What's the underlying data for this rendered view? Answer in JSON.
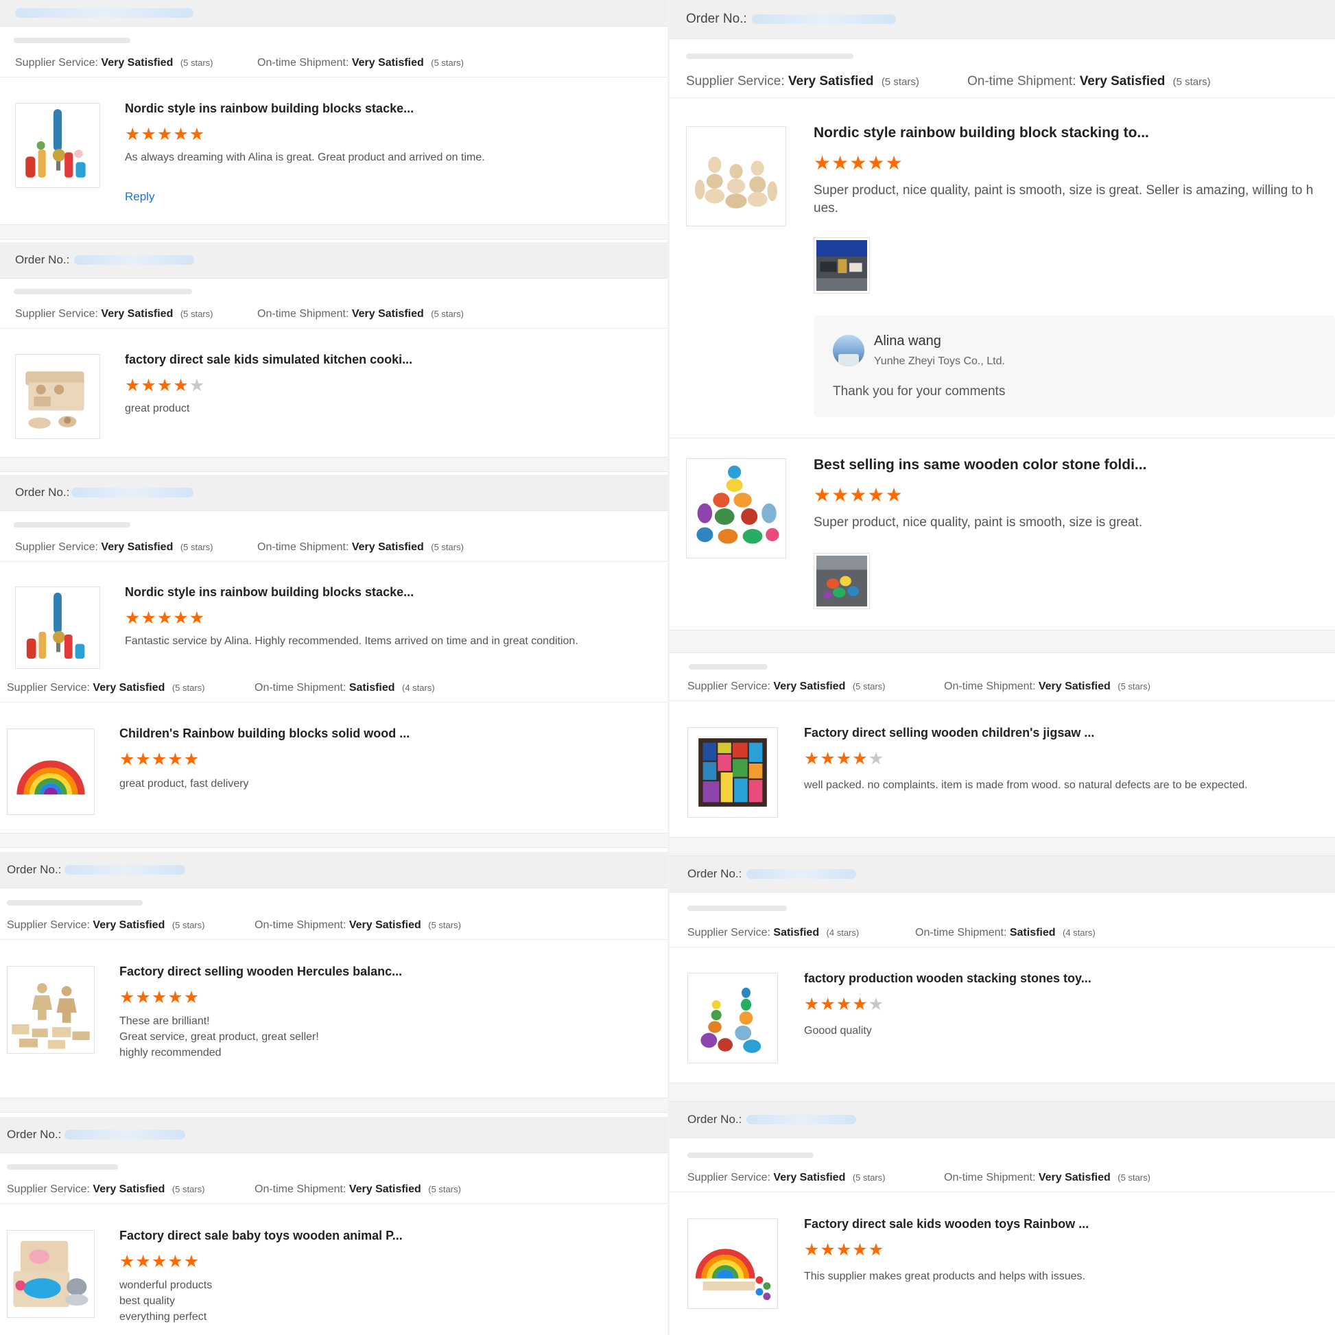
{
  "labels": {
    "order_no": "Order No.:",
    "supplier_service": "Supplier Service:",
    "ontime_shipment": "On-time Shipment:",
    "reply": "Reply"
  },
  "icons": {
    "star_filled": "★",
    "star_empty": "★"
  },
  "colors": {
    "star": "#ff6a00",
    "link": "#1a73d9",
    "order_bar": "#f0f0f0"
  },
  "left": [
    {
      "supplier_value": "Very Satisfied",
      "supplier_stars": "(5 stars)",
      "shipment_value": "Very Satisfied",
      "shipment_stars": "(5 stars)",
      "product_title": "Nordic style ins rainbow building blocks stacke...",
      "rating": 5,
      "review_lines": [
        "As always dreaming with Alina is great. Great product and arrived on time."
      ]
    },
    {
      "supplier_value": "Very Satisfied",
      "supplier_stars": "(5 stars)",
      "shipment_value": "Very Satisfied",
      "shipment_stars": "(5 stars)",
      "product_title": "factory direct sale kids simulated kitchen cooki...",
      "rating": 4,
      "review_lines": [
        "great product"
      ]
    },
    {
      "supplier_value": "Very Satisfied",
      "supplier_stars": "(5 stars)",
      "shipment_value": "Very Satisfied",
      "shipment_stars": "(5 stars)",
      "product_title": "Nordic style ins rainbow building blocks stacke...",
      "rating": 5,
      "review_lines": [
        "Fantastic service by Alina. Highly recommended. Items arrived on time and in great condition."
      ]
    },
    {
      "supplier_value": "Very Satisfied",
      "supplier_stars": "(5 stars)",
      "shipment_value": "Satisfied",
      "shipment_stars": "(4 stars)",
      "product_title": "Children's Rainbow building blocks solid wood ...",
      "rating": 5,
      "review_lines": [
        "great product, fast delivery"
      ]
    },
    {
      "supplier_value": "Very Satisfied",
      "supplier_stars": "(5 stars)",
      "shipment_value": "Very Satisfied",
      "shipment_stars": "(5 stars)",
      "product_title": "Factory direct selling wooden Hercules balanc...",
      "rating": 5,
      "review_lines": [
        "These are brilliant!",
        "Great service, great product, great seller!",
        "highly recommended"
      ]
    },
    {
      "supplier_value": "Very Satisfied",
      "supplier_stars": "(5 stars)",
      "shipment_value": "Very Satisfied",
      "shipment_stars": "(5 stars)",
      "product_title": "Factory direct sale baby toys wooden animal P...",
      "rating": 5,
      "review_lines": [
        "wonderful products",
        "best quality",
        "everything perfect"
      ]
    }
  ],
  "right": [
    {
      "supplier_value": "Very Satisfied",
      "supplier_stars": "(5 stars)",
      "shipment_value": "Very Satisfied",
      "shipment_stars": "(5 stars)",
      "product_title": "Nordic style rainbow building block stacking to...",
      "rating": 5,
      "review_lines": [
        "Super product, nice quality, paint is smooth, size is great. Seller is amazing, willing to h",
        "ues."
      ],
      "seller_reply": {
        "name": "Alina wang",
        "company": "Yunhe Zheyi Toys Co., Ltd.",
        "message": "Thank you for your comments"
      }
    },
    {
      "product_title": "Best selling ins same wooden color stone foldi...",
      "rating": 5,
      "review_lines": [
        "Super product, nice quality, paint is smooth, size is great."
      ]
    },
    {
      "supplier_value": "Very Satisfied",
      "supplier_stars": "(5 stars)",
      "shipment_value": "Very Satisfied",
      "shipment_stars": "(5 stars)",
      "product_title": "Factory direct selling wooden children's jigsaw ...",
      "rating": 4,
      "review_lines": [
        "well packed. no complaints. item is made from wood. so natural defects are to be expected."
      ]
    },
    {
      "supplier_value": "Satisfied",
      "supplier_stars": "(4 stars)",
      "shipment_value": "Satisfied",
      "shipment_stars": "(4 stars)",
      "product_title": "factory production wooden stacking stones toy...",
      "rating": 4,
      "review_lines": [
        "Goood quality"
      ]
    },
    {
      "supplier_value": "Very Satisfied",
      "supplier_stars": "(5 stars)",
      "shipment_value": "Very Satisfied",
      "shipment_stars": "(5 stars)",
      "product_title": "Factory direct sale kids wooden toys Rainbow ...",
      "rating": 5,
      "review_lines": [
        "This supplier makes great products and helps with issues."
      ]
    }
  ]
}
